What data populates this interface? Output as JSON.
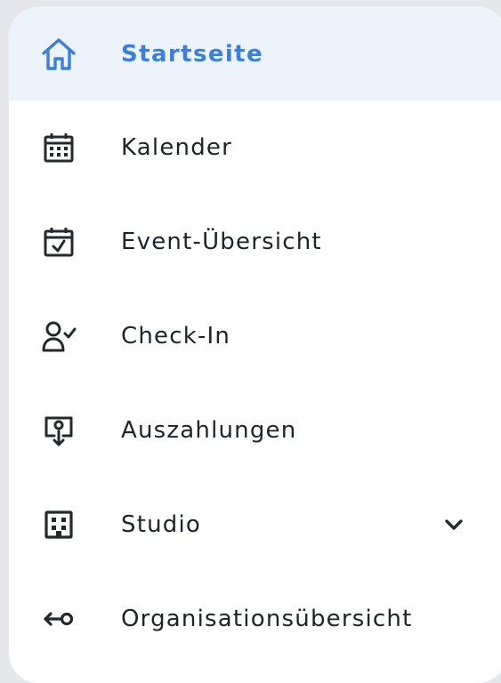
{
  "navigation": {
    "items": [
      {
        "label": "Startseite",
        "icon": "home-icon",
        "active": true
      },
      {
        "label": "Kalender",
        "icon": "calendar-icon",
        "active": false
      },
      {
        "label": "Event-Übersicht",
        "icon": "calendar-check-icon",
        "active": false
      },
      {
        "label": "Check-In",
        "icon": "user-check-icon",
        "active": false
      },
      {
        "label": "Auszahlungen",
        "icon": "payout-icon",
        "active": false
      },
      {
        "label": "Studio",
        "icon": "building-icon",
        "active": false,
        "expandable": true
      },
      {
        "label": "Organisationsübersicht",
        "icon": "switch-organization-icon",
        "active": false
      }
    ]
  },
  "colors": {
    "accent": "#3b7fdd",
    "active_background": "#edf3fb",
    "text": "#1f2328",
    "icon": "#24292f",
    "background": "#e4e6e9"
  }
}
